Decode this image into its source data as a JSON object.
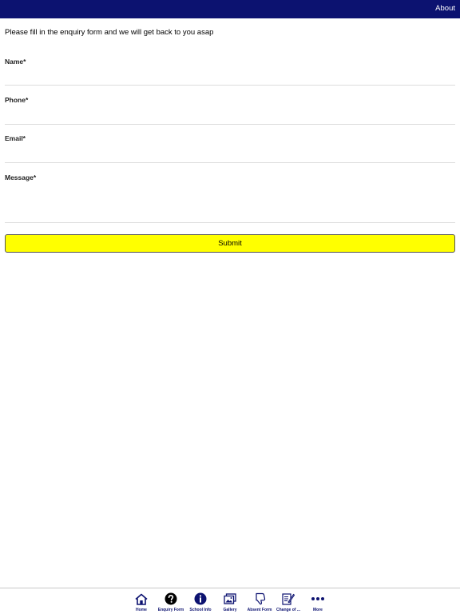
{
  "header": {
    "about_label": "About",
    "bar_color": "#0c1270"
  },
  "form": {
    "intro_text": "Please fill in the enquiry form and we will get back to you asap",
    "fields": [
      {
        "label": "Name*",
        "value": ""
      },
      {
        "label": "Phone*",
        "value": ""
      },
      {
        "label": "Email*",
        "value": ""
      },
      {
        "label": "Message*",
        "value": ""
      }
    ],
    "submit_label": "Submit",
    "submit_color": "#ffff00"
  },
  "tabs": [
    {
      "label": "Home",
      "icon": "home-icon"
    },
    {
      "label": "Enquiry Form",
      "icon": "question-icon"
    },
    {
      "label": "School Info",
      "icon": "info-icon"
    },
    {
      "label": "Gallery",
      "icon": "gallery-icon"
    },
    {
      "label": "Absent Form",
      "icon": "thumbs-down-icon"
    },
    {
      "label": "Change of ...",
      "icon": "edit-icon"
    },
    {
      "label": "More",
      "icon": "more-icon"
    }
  ]
}
